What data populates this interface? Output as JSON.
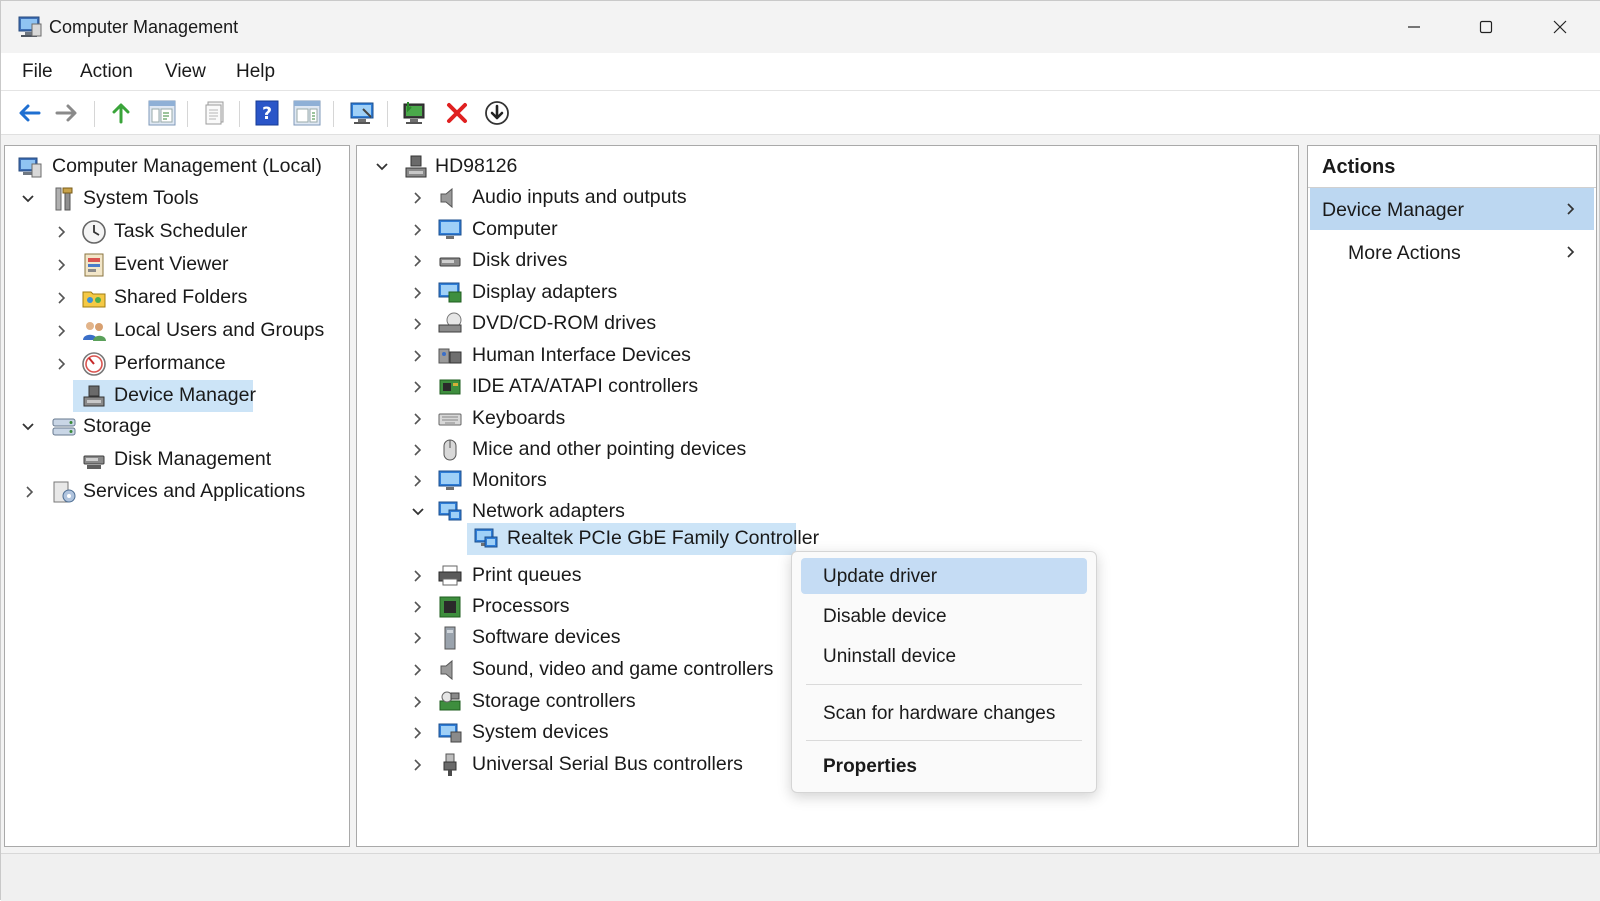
{
  "window": {
    "title": "Computer Management",
    "controls": {
      "minimize": "minimize-icon",
      "maximize": "maximize-icon",
      "close": "close-icon"
    }
  },
  "menubar": {
    "items": [
      "File",
      "Action",
      "View",
      "Help"
    ]
  },
  "toolbar": {
    "buttons": [
      "back-icon",
      "forward-icon",
      "up-icon",
      "show-hide-tree-icon",
      "export-list-icon",
      "help-icon",
      "show-action-pane-icon",
      "scan-hardware-icon",
      "update-driver-icon",
      "uninstall-icon",
      "enable-device-icon"
    ]
  },
  "left_tree": {
    "root": "Computer Management (Local)",
    "system_tools": "System Tools",
    "items": [
      "Task Scheduler",
      "Event Viewer",
      "Shared Folders",
      "Local Users and Groups",
      "Performance",
      "Device Manager"
    ],
    "storage": "Storage",
    "disk_management": "Disk Management",
    "services": "Services and Applications",
    "selected": "Device Manager"
  },
  "device_tree": {
    "root": "HD98126",
    "categories": [
      "Audio inputs and outputs",
      "Computer",
      "Disk drives",
      "Display adapters",
      "DVD/CD-ROM drives",
      "Human Interface Devices",
      "IDE ATA/ATAPI controllers",
      "Keyboards",
      "Mice and other pointing devices",
      "Monitors",
      "Network adapters",
      "Print queues",
      "Processors",
      "Software devices",
      "Sound, video and game controllers",
      "Storage controllers",
      "System devices",
      "Universal Serial Bus controllers"
    ],
    "expanded": "Network adapters",
    "network_child": "Realtek PCIe GbE Family Controller"
  },
  "context_menu": {
    "items": [
      "Update driver",
      "Disable device",
      "Uninstall device",
      "Scan for hardware changes",
      "Properties"
    ],
    "highlighted": "Update driver",
    "bold": "Properties"
  },
  "actions_pane": {
    "title": "Actions",
    "section": "Device Manager",
    "more": "More Actions"
  },
  "colors": {
    "selection": "#cce4f7",
    "menu_highlight": "#c5dcf4",
    "actions_active": "#bcd7f1",
    "accent_blue": "#1f6fd1",
    "delete_red": "#e02020"
  }
}
